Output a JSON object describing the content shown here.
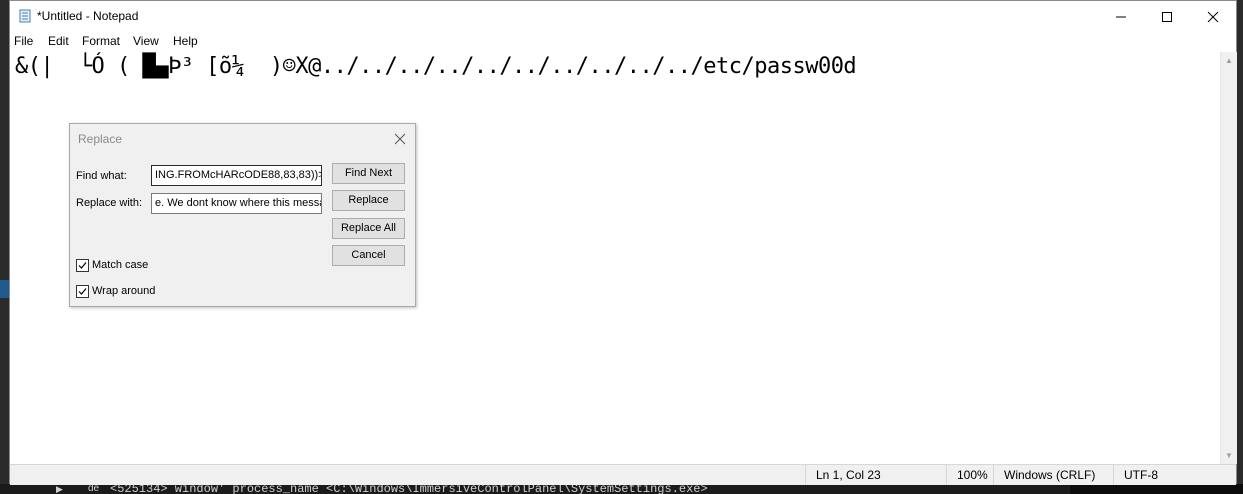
{
  "window": {
    "title": "*Untitled - Notepad"
  },
  "menu": [
    "File",
    "Edit",
    "Format",
    "View",
    "Help"
  ],
  "editor": {
    "text": "&(|  └Ó ( █▄Þ³ [õ¼  )☺X@../../../../../../../../../../etc/passw00d"
  },
  "status": {
    "position": "Ln 1, Col 23",
    "zoom": "100%",
    "line_ending": "Windows (CRLF)",
    "encoding": "UTF-8"
  },
  "dialog": {
    "title": "Replace",
    "find_label": "Find what:",
    "find_value": "ING.FROMcHARcODE88,83,83))>",
    "replace_label": "Replace with:",
    "replace_value": "e. We dont know where this messa",
    "buttons": {
      "find_next": "Find Next",
      "replace": "Replace",
      "replace_all": "Replace All",
      "cancel": "Cancel"
    },
    "match_case": {
      "label": "Match case",
      "checked": true
    },
    "wrap_around": {
      "label": "Wrap around",
      "checked": true
    }
  },
  "background": {
    "console_text": "<525134> window' process_name <C:\\Windows\\ImmersiveControlPanel\\SystemSettings.exe>",
    "console_label": "de"
  }
}
